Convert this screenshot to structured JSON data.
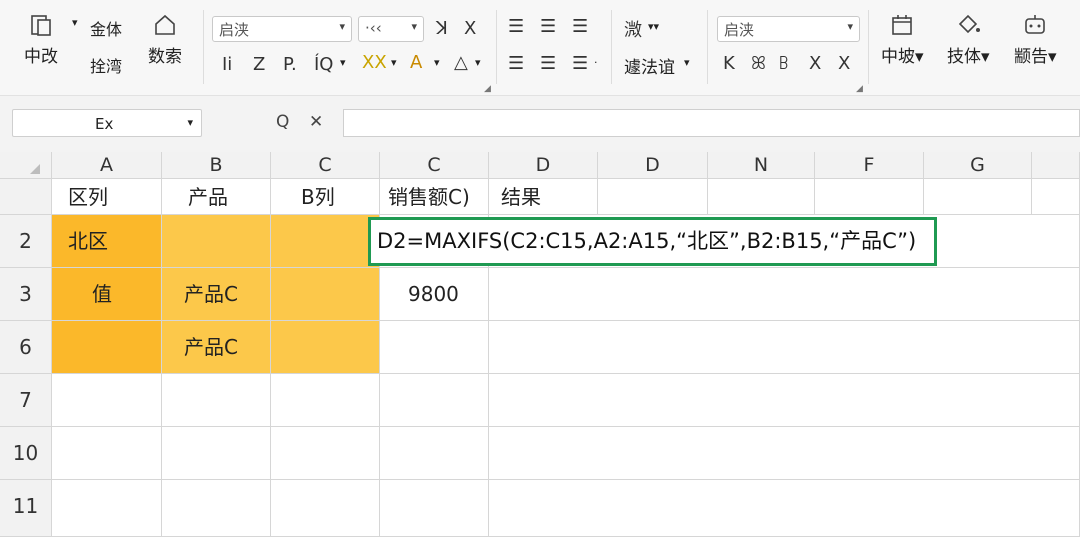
{
  "ribbon": {
    "paste": "中改",
    "paste_arrow": "▾",
    "format_painter_top": "金体",
    "format_painter_bottom": "拴湾",
    "number": "数索",
    "font_name": "启浃",
    "font_size": "·‹‹",
    "bold": "Ii",
    "italic": "Z",
    "underline": "P.",
    "border": "ÍQ",
    "fill": "ⅩⅩ",
    "font_color": "A",
    "clear": "△",
    "grow_font": "ꓘ",
    "shrink_font": "Ⅹ",
    "wrap": "溦",
    "filter": "遽法谊",
    "style_name": "启浃",
    "insert_row": "K",
    "insert_col": "ꕤ",
    "delete_row": "ꕗ",
    "delete_col": "Ⅹ",
    "clear_fmt": "Ⅹ",
    "insert": "中坡",
    "tools": "技体",
    "more": "颛告"
  },
  "formula_bar": {
    "name_box": "Ex",
    "formula": ""
  },
  "columns": [
    "A",
    "B",
    "C",
    "C",
    "D",
    "D",
    "N",
    "F",
    "G"
  ],
  "rows": [
    "2",
    "3",
    "6",
    "7",
    "10",
    "11"
  ],
  "header_row": [
    "区列",
    "产品",
    "B列",
    "销售额C)",
    "结果"
  ],
  "cells": {
    "a2": "北区",
    "a3": "值",
    "b3": "产品C",
    "b6": "产品C",
    "c3": "9800"
  },
  "callout_formula": "D2=MAXIFS(C2:C15,A2:A15,“北区”,B2:B15,“产品C”)",
  "colors": {
    "highlight_yellow": "#fcc84a",
    "highlight_orange": "#fbb82a",
    "callout_border": "#1f9a52"
  }
}
